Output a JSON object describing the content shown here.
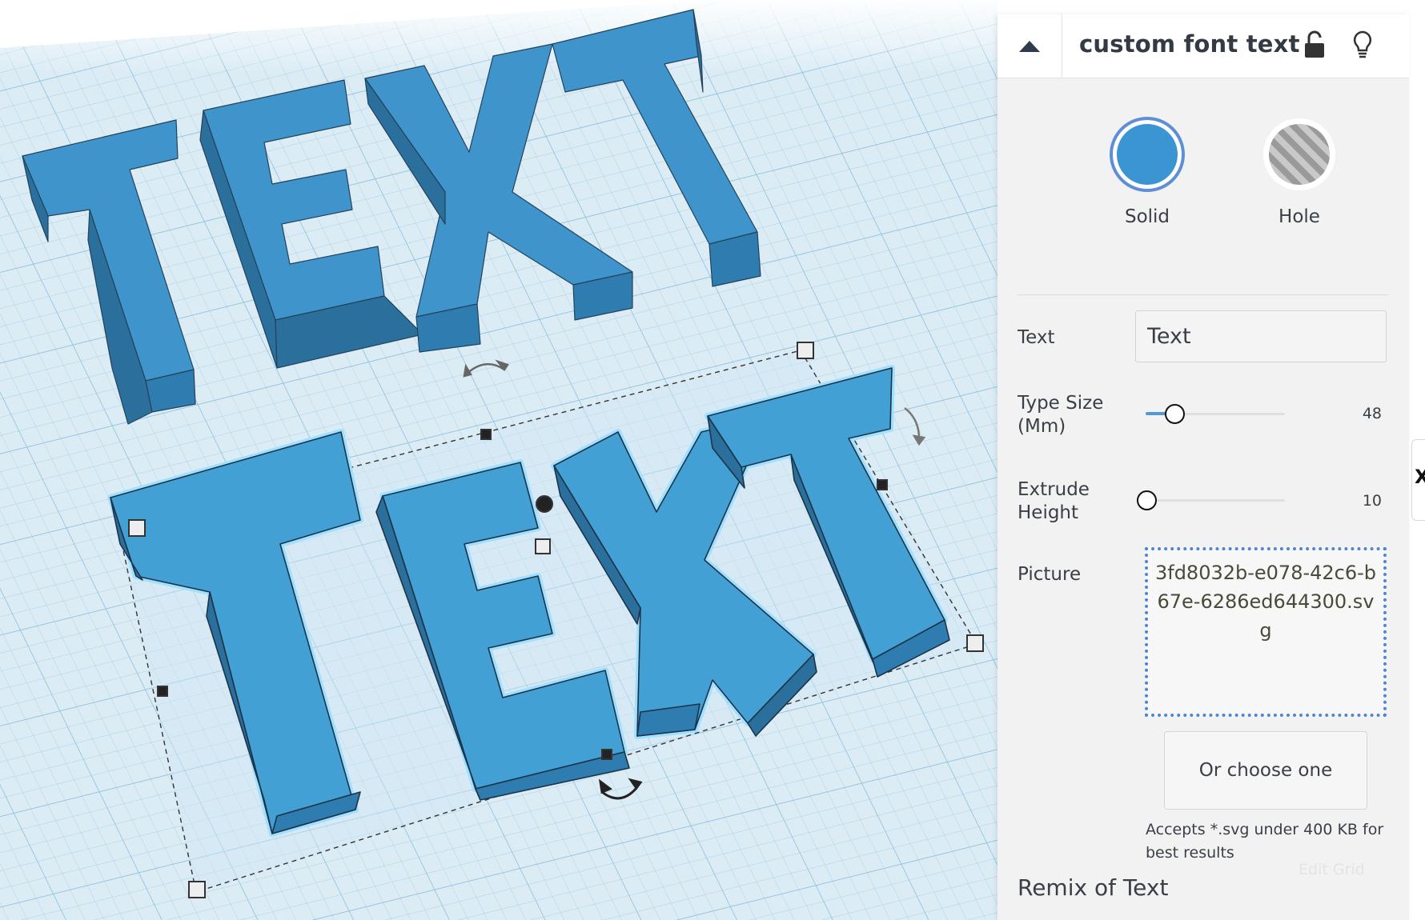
{
  "panel": {
    "title": "custom font text",
    "icons": {
      "collapse": "collapse-up-icon",
      "lock": "unlock-icon",
      "light": "lightbulb-icon"
    },
    "shape_types": [
      {
        "label": "Solid",
        "selected": true,
        "color": "#3b95d3"
      },
      {
        "label": "Hole",
        "selected": false
      }
    ],
    "properties": {
      "text": {
        "label": "Text",
        "value": "Text"
      },
      "type_size": {
        "label_line1": "Type Size",
        "label_line2": "(Mm)",
        "value": "48",
        "level": 0.2
      },
      "extrude_height": {
        "label_line1": "Extrude",
        "label_line2": "Height",
        "value": "10",
        "level": 0.0
      },
      "picture": {
        "label": "Picture",
        "filename": "3fd8032b-e078-42c6-b67e-6286ed644300.svg",
        "choose_label": "Or choose one",
        "hint": "Accepts *.svg under 400 KB for best results"
      }
    },
    "edit_grid_label": "Edit Grid",
    "remix_label": "Remix of Text"
  },
  "workplane": {
    "text_objects": [
      {
        "text": "TEXT",
        "selected": false
      },
      {
        "text": "TEXT",
        "selected": true
      }
    ],
    "colors": {
      "grid_bg": "#dcecf5",
      "grid_line": "#a9d1e6",
      "shape_fill": "#3e94cb",
      "shape_dark": "#2b6f9d",
      "selection_glow": "#7cc6ec"
    }
  },
  "side_tab": {
    "label": "X"
  }
}
